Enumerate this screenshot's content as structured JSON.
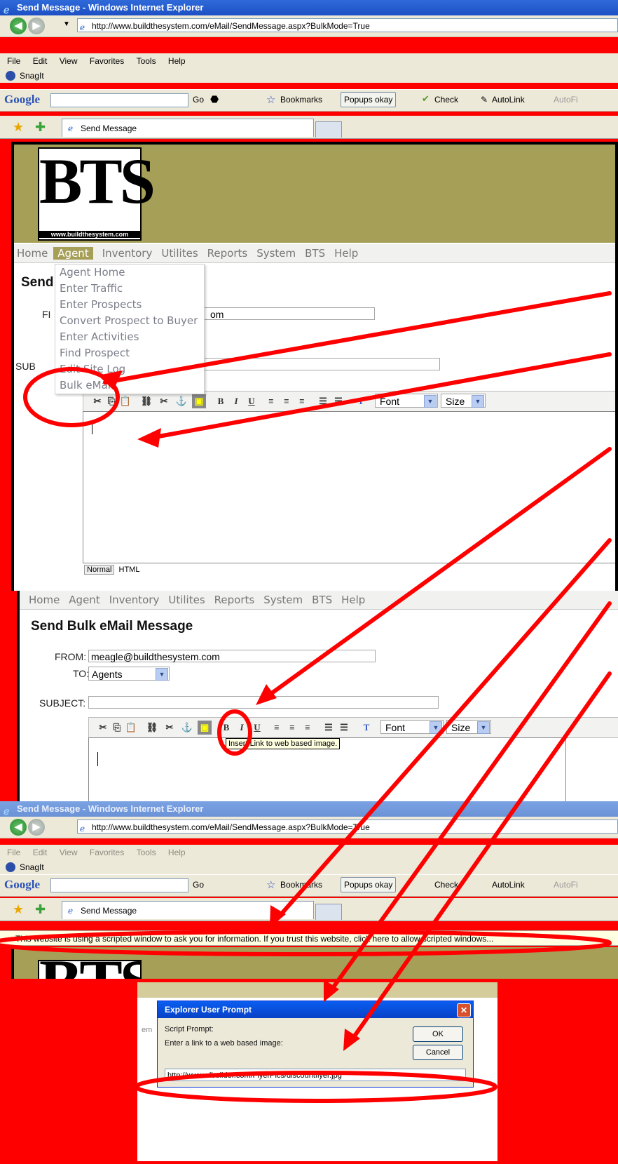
{
  "browser": {
    "window_title": "Send Message - Windows Internet Explorer",
    "url": "http://www.buildthesystem.com/eMail/SendMessage.aspx?BulkMode=True",
    "menu": [
      "File",
      "Edit",
      "View",
      "Favorites",
      "Tools",
      "Help"
    ],
    "snagit_label": "SnagIt",
    "google": {
      "logo": "Google",
      "go": "Go",
      "bookmarks": "Bookmarks",
      "popups": "Popups okay",
      "check": "Check",
      "autolink": "AutoLink",
      "autofill": "AutoFi"
    },
    "tab_label": "Send Message"
  },
  "site": {
    "logo_text": "BTS",
    "logo_url": "www.buildthesystem.com",
    "nav": [
      "Home",
      "Agent",
      "Inventory",
      "Utilites",
      "Reports",
      "System",
      "BTS",
      "Help"
    ],
    "agent_menu": [
      "Agent Home",
      "Enter Traffic",
      "Enter Prospects",
      "Convert Prospect to Buyer",
      "Enter Activities",
      "Find Prospect",
      "Edit Site Log",
      "Bulk eMail"
    ]
  },
  "form": {
    "title": "Send Bulk eMail Message",
    "title_partial": "Send",
    "from_label": "FROM:",
    "from_label_partial": "FI",
    "from_value": "meagle@buildthesystem.com",
    "from_value_partial": "om",
    "to_label": "TO:",
    "to_value": "Agents",
    "subject_label": "SUBJECT:",
    "subject_label_partial": "SUB",
    "font_select": "Font",
    "size_select": "Size",
    "mode_normal": "Normal",
    "mode_html": "HTML",
    "tooltip": "Insert Link to web based image."
  },
  "infobar": {
    "text": "This website is using a scripted window to ask you for information. If you trust this website, click here to allow scripted windows..."
  },
  "dialog": {
    "title": "Explorer User Prompt",
    "script_prompt": "Script Prompt:",
    "message": "Enter a link to a web based image:",
    "ok": "OK",
    "cancel": "Cancel",
    "input_value": "http://www.albuilder.com/FlyerPics/discountflyer.jpg",
    "behind_text": "em"
  },
  "colors": {
    "annotation": "#ff0000",
    "banner": "#a69f58",
    "ie_title": "#1c4fc4"
  }
}
